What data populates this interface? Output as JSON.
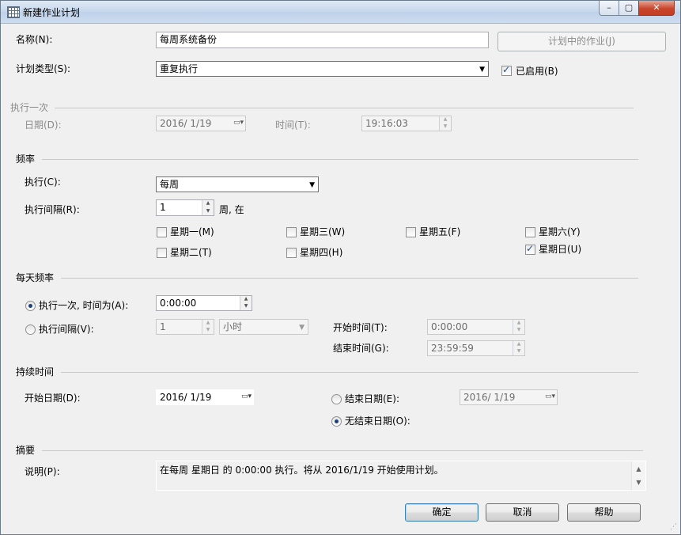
{
  "window": {
    "title": "新建作业计划",
    "minimize": "–",
    "maximize": "▢",
    "close": "✕"
  },
  "name": {
    "label": "名称(N):",
    "value": "每周系统备份"
  },
  "jobs_in_schedule_button": "计划中的作业(J)",
  "schedule_type": {
    "label": "计划类型(S):",
    "value": "重复执行"
  },
  "enabled": {
    "label": "已启用(B)",
    "checked": true
  },
  "one_time": {
    "group_label": "执行一次",
    "date_label": "日期(D):",
    "date_value": "2016/ 1/19",
    "time_label": "时间(T):",
    "time_value": "19:16:03"
  },
  "frequency": {
    "group_label": "频率",
    "occurs_label": "执行(C):",
    "occurs_value": "每周",
    "recurs_label": "执行间隔(R):",
    "recurs_value": "1",
    "recurs_suffix": "周, 在",
    "days": [
      {
        "label": "星期一(M)",
        "checked": false
      },
      {
        "label": "星期二(T)",
        "checked": false
      },
      {
        "label": "星期三(W)",
        "checked": false
      },
      {
        "label": "星期四(H)",
        "checked": false
      },
      {
        "label": "星期五(F)",
        "checked": false
      },
      {
        "label": "星期六(Y)",
        "checked": false
      },
      {
        "label": "星期日(U)",
        "checked": true
      }
    ]
  },
  "daily_frequency": {
    "group_label": "每天频率",
    "once_label": "执行一次, 时间为(A):",
    "once_value": "0:00:00",
    "once_selected": true,
    "every_label": "执行间隔(V):",
    "every_value": "1",
    "every_unit": "小时",
    "start_label": "开始时间(T):",
    "start_value": "0:00:00",
    "end_label": "结束时间(G):",
    "end_value": "23:59:59"
  },
  "duration": {
    "group_label": "持续时间",
    "start_date_label": "开始日期(D):",
    "start_date_value": "2016/ 1/19",
    "end_date_label": "结束日期(E):",
    "end_date_value": "2016/ 1/19",
    "no_end_label": "无结束日期(O):",
    "no_end_selected": true
  },
  "summary": {
    "group_label": "摘要",
    "description_label": "说明(P):",
    "description_value": "在每周 星期日 的 0:00:00 执行。将从 2016/1/19 开始使用计划。"
  },
  "buttons": {
    "ok": "确定",
    "cancel": "取消",
    "help": "帮助"
  }
}
